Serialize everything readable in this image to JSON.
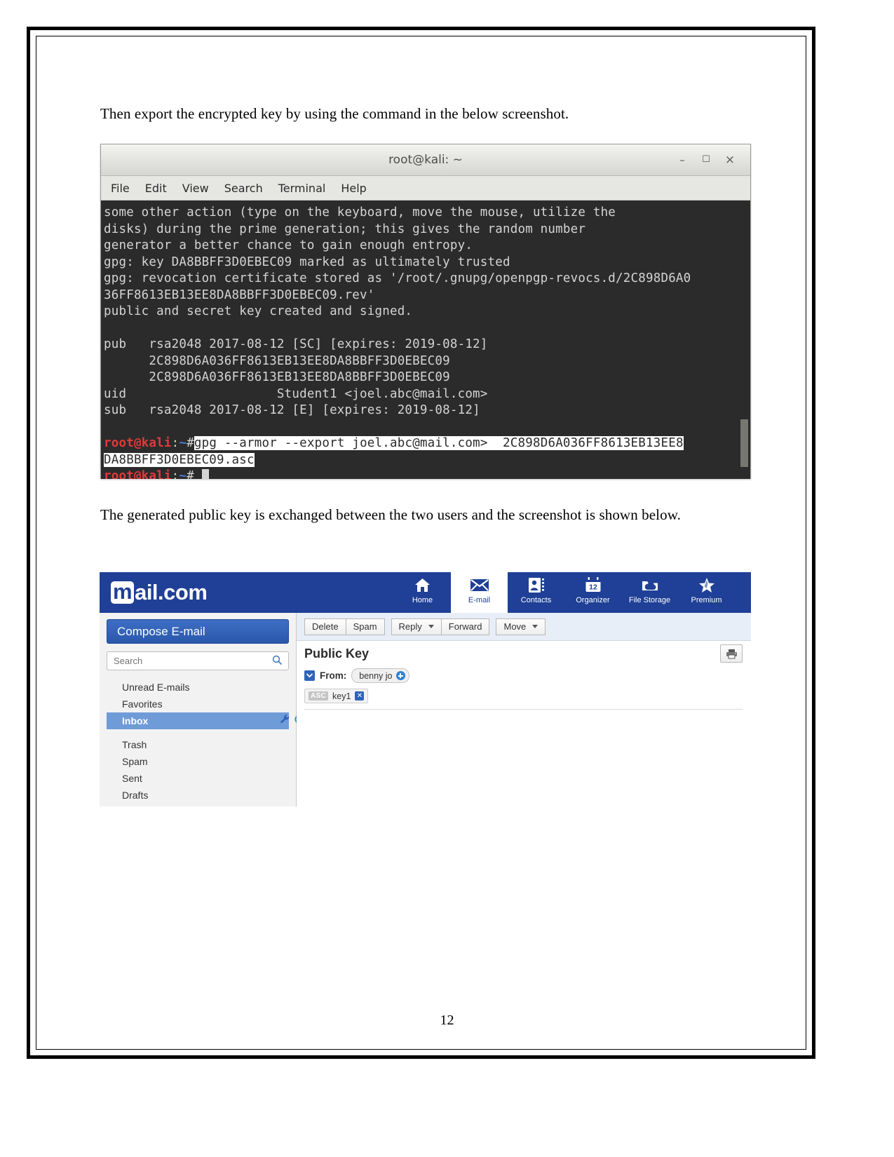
{
  "document": {
    "paragraph_1": "Then export the encrypted key by using the command in the below screenshot.",
    "paragraph_2": "The generated public key is exchanged between the two users and the screenshot is shown below.",
    "page_number": "12"
  },
  "terminal": {
    "title": "root@kali: ~",
    "window_buttons": {
      "minimize": "–",
      "maximize": "☐",
      "close": "×"
    },
    "menu": [
      "File",
      "Edit",
      "View",
      "Search",
      "Terminal",
      "Help"
    ],
    "lines": [
      "some other action (type on the keyboard, move the mouse, utilize the",
      "disks) during the prime generation; this gives the random number",
      "generator a better chance to gain enough entropy.",
      "gpg: key DA8BBFF3D0EBEC09 marked as ultimately trusted",
      "gpg: revocation certificate stored as '/root/.gnupg/openpgp-revocs.d/2C898D6A0",
      "36FF8613EB13EE8DA8BBFF3D0EBEC09.rev'",
      "public and secret key created and signed.",
      "",
      "pub   rsa2048 2017-08-12 [SC] [expires: 2019-08-12]",
      "      2C898D6A036FF8613EB13EE8DA8BBFF3D0EBEC09",
      "      2C898D6A036FF8613EB13EE8DA8BBFF3D0EBEC09",
      "uid                    Student1 <joel.abc@mail.com>",
      "sub   rsa2048 2017-08-12 [E] [expires: 2019-08-12]",
      ""
    ],
    "prompt": {
      "user_host": "root@kali",
      "colon": ":",
      "path": "~",
      "hash": "#"
    },
    "command_line_1": "gpg --armor --export joel.abc@mail.com>  2C898D6A036FF8613EB13EE8",
    "command_line_2": "DA8BBFF3D0EBEC09.asc",
    "colors": {
      "background": "#2b2b2b",
      "text": "#d4d4d4",
      "prompt_user": "#e03a3a",
      "prompt_path": "#4a7fd6",
      "selection_bg": "#ffffff"
    }
  },
  "mail": {
    "logo": {
      "m": "m",
      "rest": "ail.com"
    },
    "nav": [
      {
        "label": "Home",
        "icon": "home-icon",
        "active": false
      },
      {
        "label": "E-mail",
        "icon": "envelope-icon",
        "active": true
      },
      {
        "label": "Contacts",
        "icon": "contacts-icon",
        "active": false
      },
      {
        "label": "Organizer",
        "icon": "calendar-icon",
        "active": false,
        "day": "12"
      },
      {
        "label": "File Storage",
        "icon": "cloud-folder-icon",
        "active": false
      },
      {
        "label": "Premium",
        "icon": "star-icon",
        "active": false
      }
    ],
    "sidebar": {
      "compose_label": "Compose E-mail",
      "search_placeholder": "Search",
      "search_value": "",
      "folders_top": [
        {
          "label": "Unread E-mails",
          "selected": false
        },
        {
          "label": "Favorites",
          "selected": false
        },
        {
          "label": "Inbox",
          "selected": true
        }
      ],
      "folders_bottom": [
        {
          "label": "Trash",
          "selected": false
        },
        {
          "label": "Spam",
          "selected": false
        },
        {
          "label": "Sent",
          "selected": false
        },
        {
          "label": "Drafts",
          "selected": false
        }
      ]
    },
    "toolbar": {
      "delete_label": "Delete",
      "spam_label": "Spam",
      "reply_label": "Reply",
      "forward_label": "Forward",
      "move_label": "Move"
    },
    "message": {
      "subject": "Public Key",
      "from_label": "From:",
      "from_value": "benny jo",
      "attachment_type": "ASC",
      "attachment_name": "key1",
      "attachment_close": "✕"
    },
    "colors": {
      "brand_blue": "#1f4096",
      "compose_blue": "#2a57ab",
      "selected_folder": "#6f9bd8",
      "toolbar_bg": "#e8eef8"
    }
  }
}
